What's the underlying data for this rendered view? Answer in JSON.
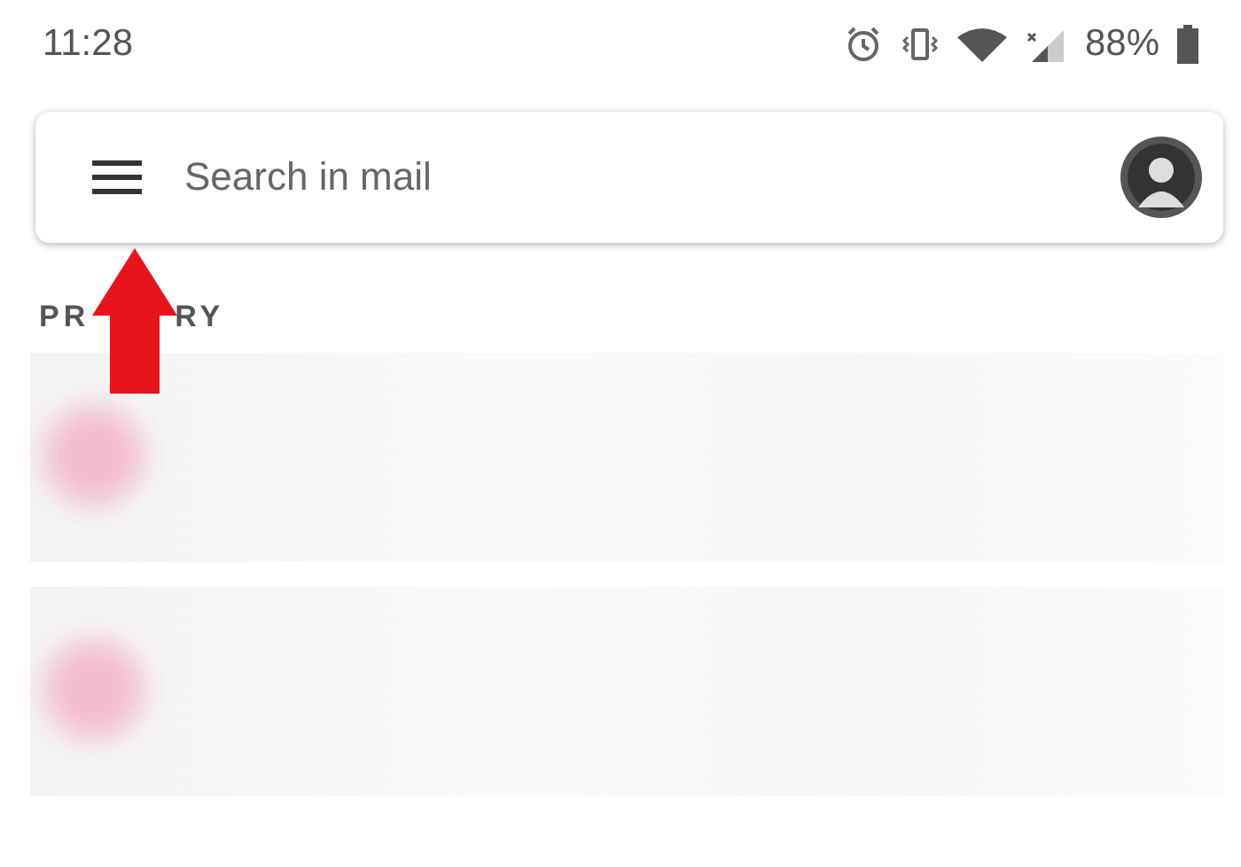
{
  "status_bar": {
    "time": "11:28",
    "battery": "88%"
  },
  "search": {
    "placeholder": "Search in mail"
  },
  "section_label": {
    "parts": [
      "PR",
      "RY"
    ]
  },
  "rows": [
    {
      "kind": "blurred"
    },
    {
      "kind": "blurred"
    }
  ]
}
